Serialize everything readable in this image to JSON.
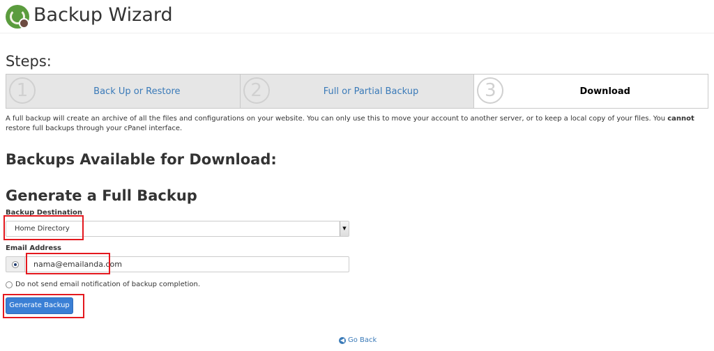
{
  "header": {
    "title": "Backup Wizard",
    "logo_icon": "cpanel-backup-logo-icon"
  },
  "steps": {
    "label": "Steps:",
    "items": [
      {
        "number": "1",
        "label": "Back Up or Restore"
      },
      {
        "number": "2",
        "label": "Full or Partial Backup"
      },
      {
        "number": "3",
        "label": "Download"
      }
    ],
    "active_index": 2
  },
  "description": {
    "before": "A full backup will create an archive of all the files and configurations on your website. You can only use this to move your account to another server, or to keep a local copy of your files. You ",
    "emphasis": "cannot",
    "after": " restore full backups through your cPanel interface."
  },
  "sections": {
    "available_heading": "Backups Available for Download:",
    "generate_heading": "Generate a Full Backup"
  },
  "form": {
    "destination_label": "Backup Destination",
    "destination_value": "Home Directory",
    "email_label": "Email Address",
    "email_value": "nama@emailanda.com",
    "no_email_label": "Do not send email notification of backup completion.",
    "generate_button": "Generate Backup"
  },
  "footer": {
    "go_back": "Go Back",
    "go_back_icon": "arrow-left-circle-icon"
  },
  "colors": {
    "accent": "#3a7fd5",
    "link": "#3a7ab8",
    "highlight": "#e4181e"
  }
}
